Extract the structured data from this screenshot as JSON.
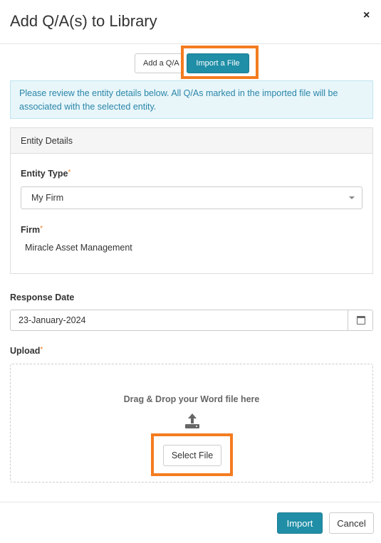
{
  "dialog": {
    "title": "Add Q/A(s) to Library",
    "close_icon": "×"
  },
  "tabs": {
    "add_label": "Add a Q/A",
    "import_label": "Import a File",
    "active": "Import a File"
  },
  "info_message": "Please review the entity details below. All Q/As marked in the imported file will be associated with the selected entity.",
  "entity_panel": {
    "heading": "Entity Details",
    "entity_type_label": "Entity Type",
    "entity_type_value": "My Firm",
    "firm_label": "Firm",
    "firm_value": "Miracle Asset Management",
    "required_marker": "*"
  },
  "response_date": {
    "label": "Response Date",
    "value": "23-January-2024"
  },
  "upload": {
    "label": "Upload",
    "required_marker": "*",
    "drop_text": "Drag & Drop your Word file here",
    "select_button": "Select File"
  },
  "footer": {
    "import_button": "Import",
    "cancel_button": "Cancel"
  },
  "colors": {
    "accent": "#1f8ea6",
    "highlight": "#f47c20",
    "info_bg": "#e8f6fa",
    "info_text": "#2a85a8"
  },
  "icons": [
    "close-icon",
    "calendar-icon",
    "upload-icon",
    "chevron-down-icon"
  ]
}
